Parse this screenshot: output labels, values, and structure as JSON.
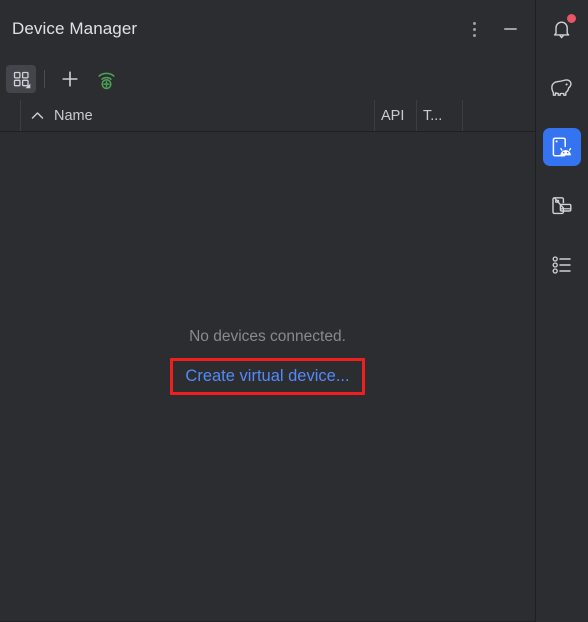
{
  "window": {
    "title": "Device Manager",
    "header_actions": [
      {
        "name": "more-options",
        "icon": "kebab-menu-icon",
        "label": "Options"
      },
      {
        "name": "minimize",
        "icon": "minimize-icon",
        "label": "Hide"
      }
    ]
  },
  "toolbar": {
    "items": [
      {
        "name": "device-grouping",
        "icon": "grid-dropdown-icon",
        "label": "Device grouping"
      },
      {
        "name": "separator",
        "icon": "separator",
        "label": ""
      },
      {
        "name": "add-device",
        "icon": "plus-icon",
        "label": "Add a new device"
      },
      {
        "name": "pair-wifi",
        "icon": "wifi-pair-icon",
        "label": "Pair using Wi-Fi"
      }
    ]
  },
  "table": {
    "columns": [
      {
        "key": "gutter",
        "label": ""
      },
      {
        "key": "name",
        "label": "Name",
        "sort": "ascending",
        "sort_icon": "caret-up-icon"
      },
      {
        "key": "api",
        "label": "API"
      },
      {
        "key": "type",
        "label": "T..."
      },
      {
        "key": "actions",
        "label": ""
      }
    ],
    "rows": [],
    "empty_state": {
      "message": "No devices connected.",
      "action_label": "Create virtual device...",
      "action_color": "#548af7",
      "highlight_color": "#f01f1f"
    }
  },
  "stripe": {
    "items": [
      {
        "name": "notifications",
        "icon": "bell-icon",
        "label": "Notifications",
        "selected": false,
        "badge": true
      },
      {
        "name": "gradle",
        "icon": "elephant-icon",
        "label": "Gradle",
        "selected": false,
        "badge": false
      },
      {
        "name": "device-manager",
        "icon": "device-manager-icon",
        "label": "Device Manager",
        "selected": true,
        "badge": false
      },
      {
        "name": "running-devices",
        "icon": "running-devices-icon",
        "label": "Running Devices",
        "selected": false,
        "badge": false
      },
      {
        "name": "build-variants",
        "icon": "bullet-list-icon",
        "label": "Build Variants",
        "selected": false,
        "badge": false
      }
    ],
    "selected_color": "#3574f0",
    "badge_color": "#e55765"
  }
}
